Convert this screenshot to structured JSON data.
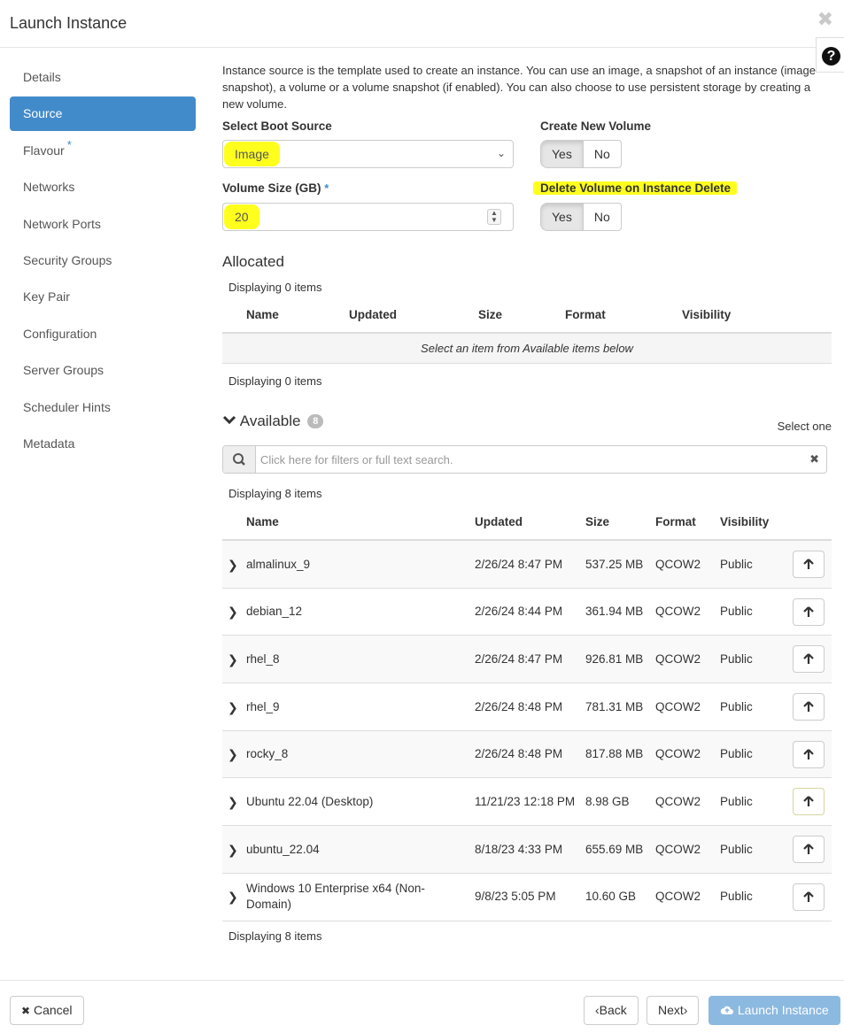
{
  "window": {
    "title": "Launch Instance"
  },
  "sidebar": {
    "items": [
      {
        "label": "Details"
      },
      {
        "label": "Source"
      },
      {
        "label": "Flavour",
        "required_marker": "*"
      },
      {
        "label": "Networks"
      },
      {
        "label": "Network Ports"
      },
      {
        "label": "Security Groups"
      },
      {
        "label": "Key Pair"
      },
      {
        "label": "Configuration"
      },
      {
        "label": "Server Groups"
      },
      {
        "label": "Scheduler Hints"
      },
      {
        "label": "Metadata"
      }
    ],
    "active": "Source"
  },
  "source": {
    "intro": "Instance source is the template used to create an instance. You can use an image, a snapshot of an instance (image snapshot), a volume or a volume snapshot (if enabled). You can also choose to use persistent storage by creating a new volume.",
    "boot_source_label": "Select Boot Source",
    "boot_source_value": "Image",
    "volume_size_label": "Volume Size (GB)",
    "volume_size_required": "*",
    "volume_size_value": "20",
    "create_volume_label": "Create New Volume",
    "create_volume_yes": "Yes",
    "create_volume_no": "No",
    "delete_volume_label": "Delete Volume on Instance Delete",
    "delete_volume_yes": "Yes",
    "delete_volume_no": "No"
  },
  "allocated": {
    "title": "Allocated",
    "displaying_top": "Displaying 0 items",
    "displaying_bottom": "Displaying 0 items",
    "columns": [
      "Name",
      "Updated",
      "Size",
      "Format",
      "Visibility"
    ],
    "empty_message": "Select an item from Available items below"
  },
  "available": {
    "title": "Available",
    "count": "8",
    "select_hint": "Select one",
    "search_placeholder": "Click here for filters or full text search.",
    "displaying_top": "Displaying 8 items",
    "displaying_bottom": "Displaying 8 items",
    "columns": [
      "Name",
      "Updated",
      "Size",
      "Format",
      "Visibility"
    ],
    "rows": [
      {
        "name": "almalinux_9",
        "updated": "2/26/24 8:47 PM",
        "size": "537.25 MB",
        "format": "QCOW2",
        "visibility": "Public"
      },
      {
        "name": "debian_12",
        "updated": "2/26/24 8:44 PM",
        "size": "361.94 MB",
        "format": "QCOW2",
        "visibility": "Public"
      },
      {
        "name": "rhel_8",
        "updated": "2/26/24 8:47 PM",
        "size": "926.81 MB",
        "format": "QCOW2",
        "visibility": "Public"
      },
      {
        "name": "rhel_9",
        "updated": "2/26/24 8:48 PM",
        "size": "781.31 MB",
        "format": "QCOW2",
        "visibility": "Public"
      },
      {
        "name": "rocky_8",
        "updated": "2/26/24 8:48 PM",
        "size": "817.88 MB",
        "format": "QCOW2",
        "visibility": "Public"
      },
      {
        "name": "Ubuntu 22.04 (Desktop)",
        "updated": "11/21/23 12:18 PM",
        "size": "8.98 GB",
        "format": "QCOW2",
        "visibility": "Public"
      },
      {
        "name": "ubuntu_22.04",
        "updated": "8/18/23 4:33 PM",
        "size": "655.69 MB",
        "format": "QCOW2",
        "visibility": "Public"
      },
      {
        "name": "Windows 10 Enterprise x64 (Non-Domain)",
        "updated": "9/8/23 5:05 PM",
        "size": "10.60 GB",
        "format": "QCOW2",
        "visibility": "Public"
      }
    ]
  },
  "footer": {
    "cancel_label": "Cancel",
    "back_label": "Back",
    "next_label": "Next",
    "launch_label": "Launch Instance"
  },
  "icons": {
    "close": "close-icon",
    "help": "question-circle-icon",
    "search": "search-icon",
    "expand": "chevron-right-icon",
    "allocate": "arrow-up-icon",
    "cloud_upload": "cloud-upload-icon"
  },
  "colors": {
    "accent": "#428bca",
    "primary_disabled": "#8cb9e0",
    "highlight": "#ffff1e"
  }
}
